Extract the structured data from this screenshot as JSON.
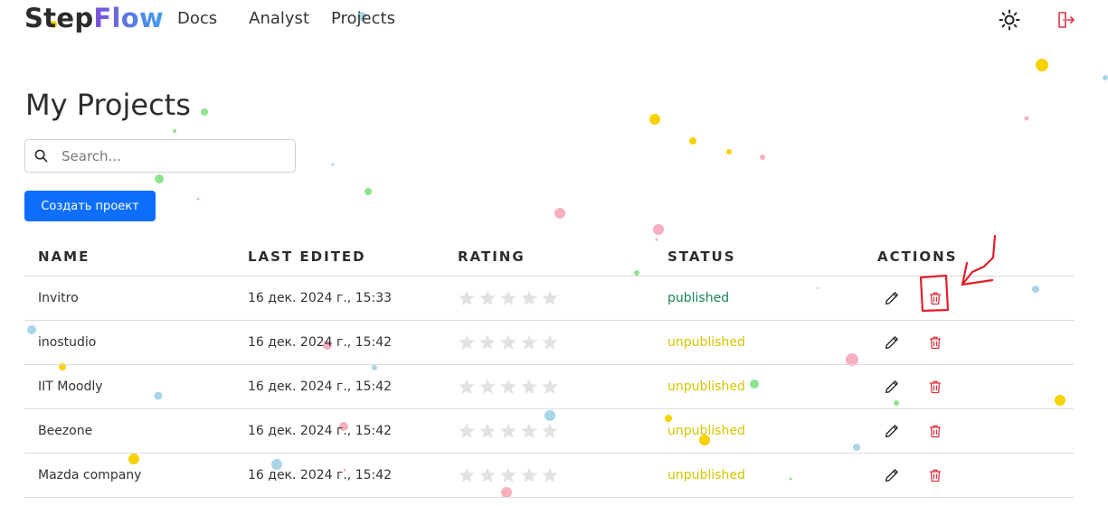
{
  "brand": {
    "part1": "Step",
    "part2": "Flow"
  },
  "nav": {
    "items": [
      "Docs",
      "Analyst",
      "Projects"
    ]
  },
  "header_icons": {
    "theme": "sun-icon",
    "logout": "logout-icon"
  },
  "page": {
    "title": "My Projects"
  },
  "search": {
    "placeholder": "Search..."
  },
  "create_button": {
    "label": "Создать проект"
  },
  "table": {
    "headers": {
      "name": "NAME",
      "last_edited": "LAST EDITED",
      "rating": "RATING",
      "status": "STATUS",
      "actions": "ACTIONS"
    },
    "rows": [
      {
        "name": "Invitro",
        "last_edited": "16 дек. 2024 г., 15:33",
        "rating": 0,
        "status": "published"
      },
      {
        "name": "inostudio",
        "last_edited": "16 дек. 2024 г., 15:42",
        "rating": 0,
        "status": "unpublished"
      },
      {
        "name": "IIT Moodly",
        "last_edited": "16 дек. 2024 г., 15:42",
        "rating": 0,
        "status": "unpublished"
      },
      {
        "name": "Beezone",
        "last_edited": "16 дек. 2024 г., 15:42",
        "rating": 0,
        "status": "unpublished"
      },
      {
        "name": "Mazda company",
        "last_edited": "16 дек. 2024 г., 15:42",
        "rating": 0,
        "status": "unpublished"
      }
    ]
  },
  "colors": {
    "primary": "#0d6efd",
    "published": "#198754",
    "unpublished": "#d4c400",
    "delete": "#dc3545",
    "annotation": "#e0202a"
  }
}
